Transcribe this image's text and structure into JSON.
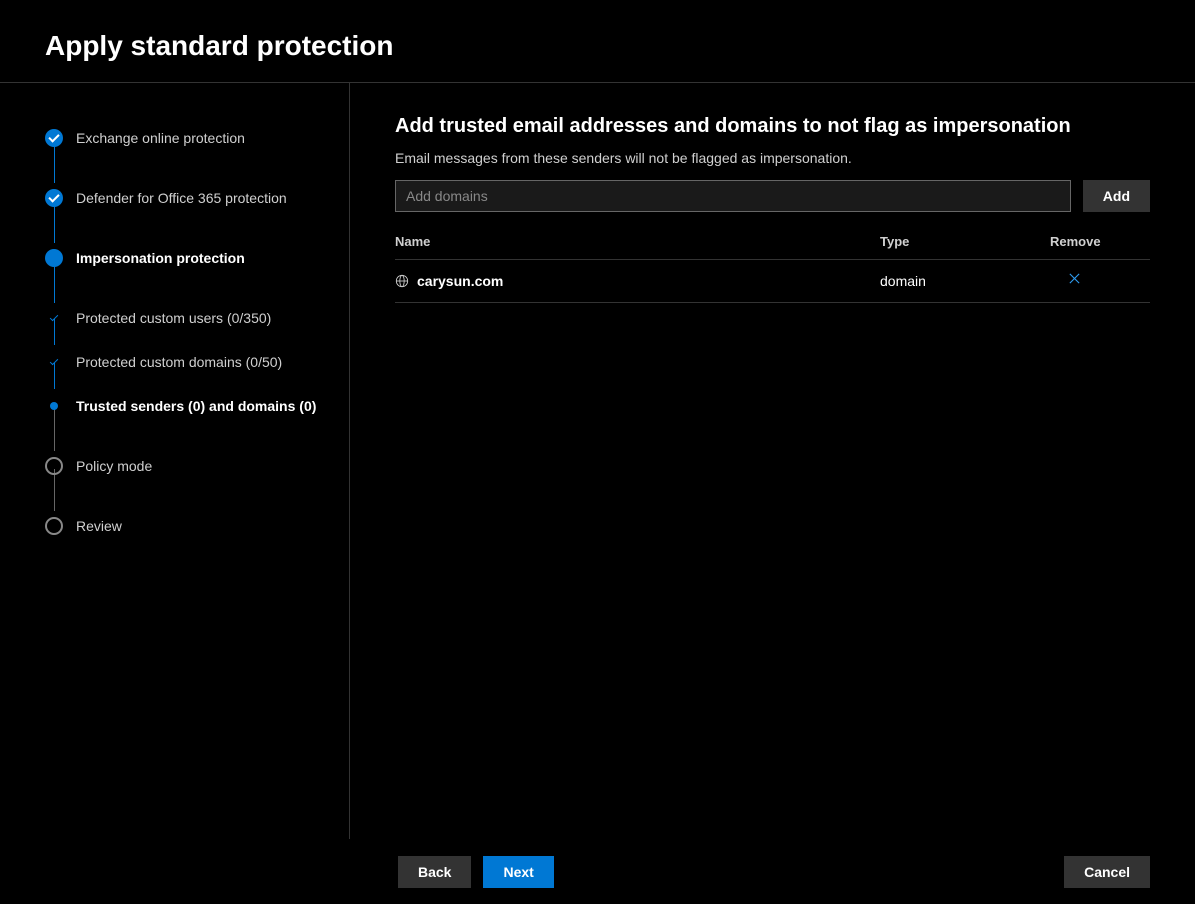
{
  "header": {
    "title": "Apply standard protection"
  },
  "sidebar": {
    "steps": {
      "s1": "Exchange online protection",
      "s2": "Defender for Office 365 protection",
      "s3": "Impersonation protection",
      "s3a": "Protected custom users (0/350)",
      "s3b": "Protected custom domains (0/50)",
      "s3c": "Trusted senders (0) and domains (0)",
      "s4": "Policy mode",
      "s5": "Review"
    }
  },
  "main": {
    "title": "Add trusted email addresses and domains to not flag as impersonation",
    "description": "Email messages from these senders will not be flagged as impersonation.",
    "input_placeholder": "Add domains",
    "add_button": "Add",
    "columns": {
      "name": "Name",
      "type": "Type",
      "remove": "Remove"
    },
    "rows": [
      {
        "name": "carysun.com",
        "type": "domain"
      }
    ]
  },
  "footer": {
    "back": "Back",
    "next": "Next",
    "cancel": "Cancel"
  }
}
